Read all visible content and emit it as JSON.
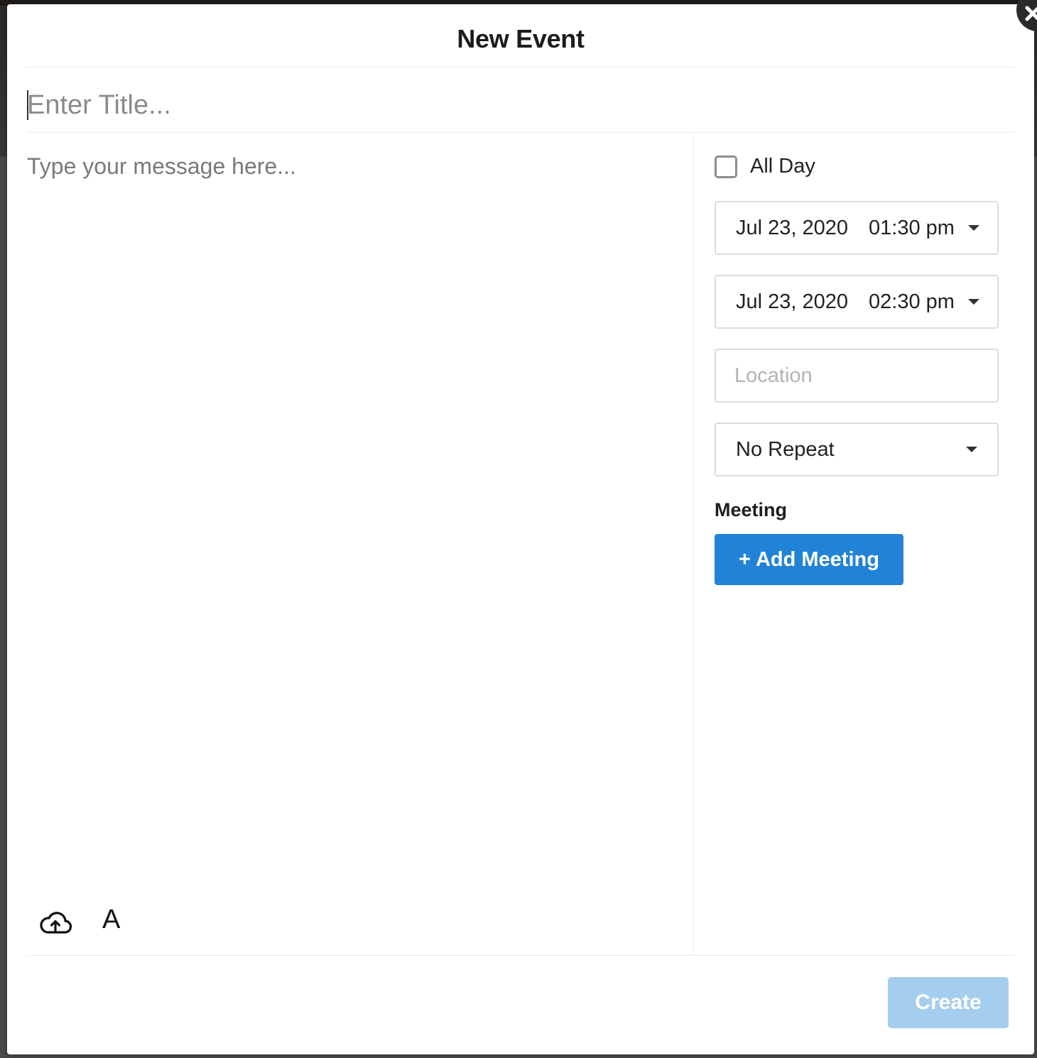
{
  "modal": {
    "title": "New Event",
    "close_icon": "close-icon"
  },
  "form": {
    "title_placeholder": "Enter Title...",
    "title_value": "",
    "message_placeholder": "Type your message here...",
    "message_value": ""
  },
  "toolbar": {
    "upload_icon": "cloud-upload-icon",
    "font_label": "A"
  },
  "schedule": {
    "all_day_label": "All Day",
    "all_day_checked": false,
    "start": {
      "date": "Jul 23, 2020",
      "time": "01:30 pm"
    },
    "end": {
      "date": "Jul 23, 2020",
      "time": "02:30 pm"
    },
    "location_placeholder": "Location",
    "location_value": "",
    "repeat": {
      "selected": "No Repeat"
    }
  },
  "meeting": {
    "section_label": "Meeting",
    "add_button_label": "+ Add Meeting"
  },
  "footer": {
    "create_label": "Create",
    "create_enabled": false
  },
  "colors": {
    "primary": "#2283d6",
    "primary_disabled": "#a4cdee",
    "border": "#dcdcdc",
    "divider": "#ececec"
  }
}
